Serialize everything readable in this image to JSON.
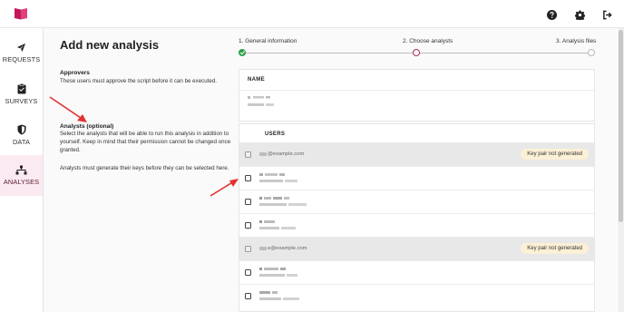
{
  "colors": {
    "brand": "#c2185b",
    "accent": "#b0285e",
    "success": "#2aa148",
    "active_bg": "#fbeaf1",
    "badge_bg": "#fcf0d6",
    "annotation": "#e53131"
  },
  "topbar": {
    "icons": [
      "help-icon",
      "gear-icon",
      "logout-icon"
    ]
  },
  "sidebar": {
    "items": [
      {
        "label": "REQUESTS",
        "icon": "send-icon",
        "active": false
      },
      {
        "label": "SURVEYS",
        "icon": "clipboard-icon",
        "active": false
      },
      {
        "label": "DATA",
        "icon": "shield-icon",
        "active": false
      },
      {
        "label": "ANALYSES",
        "icon": "network-icon",
        "active": true
      }
    ]
  },
  "page": {
    "title": "Add new analysis"
  },
  "steps": [
    {
      "label": "1. General information",
      "state": "done"
    },
    {
      "label": "2. Choose analysts",
      "state": "current"
    },
    {
      "label": "3. Analysis files",
      "state": "pending"
    }
  ],
  "approvers": {
    "title": "Approvers",
    "description": "These users must approve the script before it can be executed.",
    "column_header": "NAME"
  },
  "analysts": {
    "title": "Analysts (optional)",
    "description": "Select the analysts that will be able to run this analysis in addition to yourself. Keep in mind that their permission cannot be changed once granted.",
    "note": "Analysts must generate their keys before they can be selected here.",
    "column_header": "USERS",
    "rows": [
      {
        "email": "@example.com",
        "disabled": true,
        "badge": "Key pair not generated"
      },
      {
        "email": "",
        "disabled": false,
        "badge": ""
      },
      {
        "email": "",
        "disabled": false,
        "badge": ""
      },
      {
        "email": "",
        "disabled": false,
        "badge": ""
      },
      {
        "email": "e@example.com",
        "disabled": true,
        "badge": "Key pair not generated"
      },
      {
        "email": "",
        "disabled": false,
        "badge": ""
      },
      {
        "email": "",
        "disabled": false,
        "badge": ""
      }
    ]
  }
}
